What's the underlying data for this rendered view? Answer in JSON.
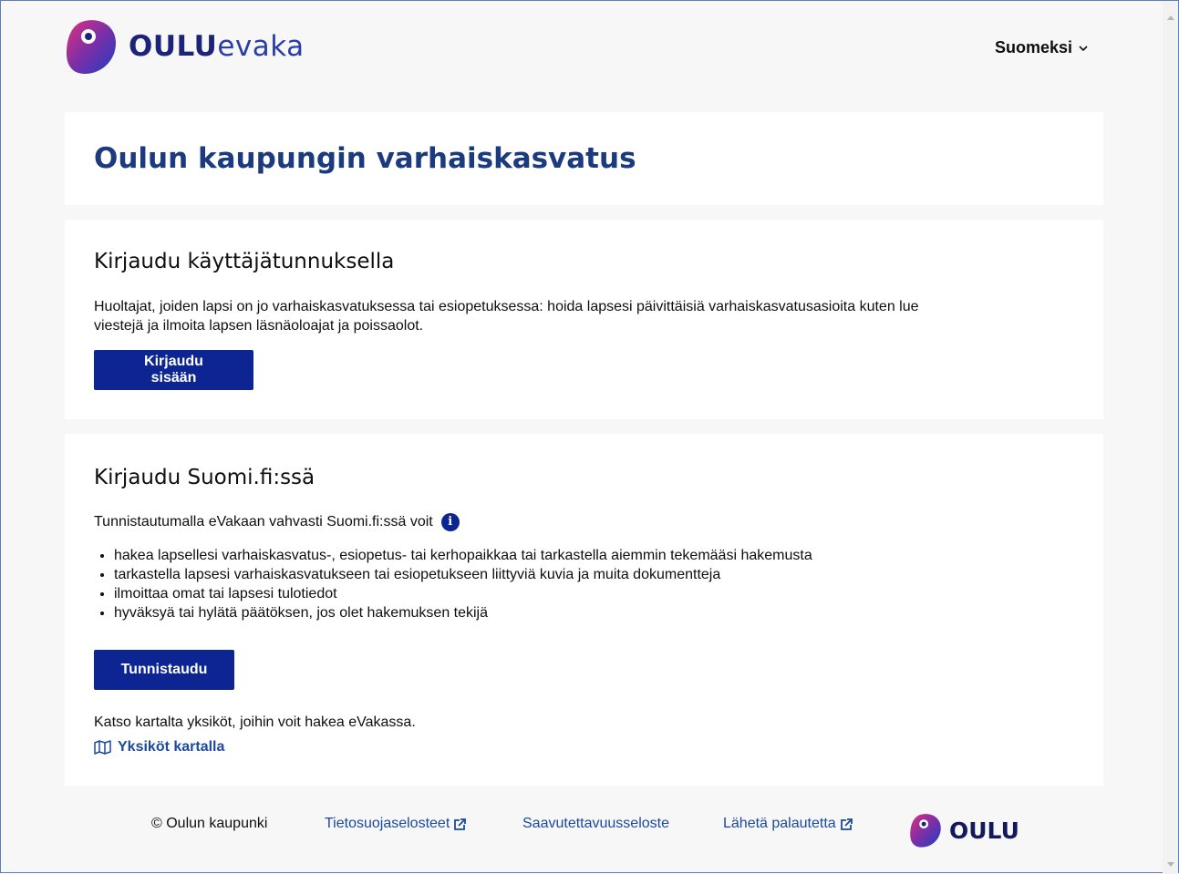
{
  "header": {
    "brand_bold": "OULU",
    "brand_light": "evaka",
    "language": "Suomeksi"
  },
  "title_card": {
    "title": "Oulun kaupungin varhaiskasvatus"
  },
  "login_card": {
    "title": "Kirjaudu käyttäjätunnuksella",
    "text": "Huoltajat, joiden lapsi on jo varhaiskasvatuksessa tai esiopetuksessa: hoida lapsesi päivittäisiä varhaiskasvatusasioita kuten lue viestejä ja ilmoita lapsen läsnäoloajat ja poissaolot.",
    "button": "Kirjaudu sisään"
  },
  "suomifi_card": {
    "title": "Kirjaudu Suomi.fi:ssä",
    "intro": "Tunnistautumalla eVakaan vahvasti Suomi.fi:ssä voit",
    "items": [
      "hakea lapsellesi varhaiskasvatus-, esiopetus- tai kerhopaikkaa tai tarkastella aiemmin tekemääsi hakemusta",
      "tarkastella lapsesi varhaiskasvatukseen tai esiopetukseen liittyviä kuvia ja muita dokumentteja",
      "ilmoittaa omat tai lapsesi tulotiedot",
      "hyväksyä tai hylätä päätöksen, jos olet hakemuksen tekijä"
    ],
    "button": "Tunnistaudu",
    "map_text": "Katso kartalta yksiköt, joihin voit hakea eVakassa.",
    "map_link": "Yksiköt kartalla"
  },
  "footer": {
    "copyright": "© Oulun kaupunki",
    "privacy": "Tietosuojaselosteet",
    "accessibility": "Saavutettavuusseloste",
    "feedback": "Lähetä palautetta",
    "logo_word": "OULU"
  },
  "colors": {
    "primary_button": "#0c2592",
    "title": "#1b3b7e",
    "link": "#1c49a0",
    "background": "#f7f7f7"
  }
}
